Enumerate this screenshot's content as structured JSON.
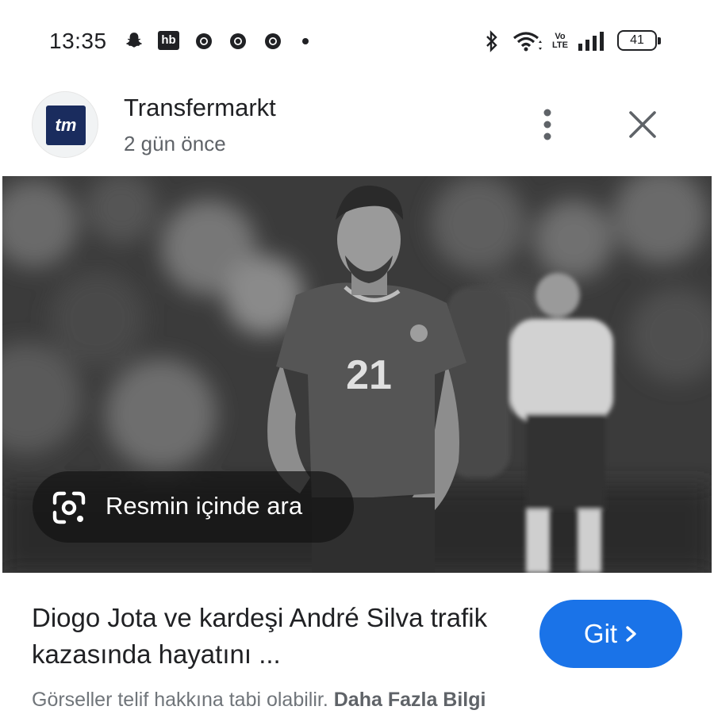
{
  "status_bar": {
    "time": "13:35",
    "left_icons": [
      "snapchat-icon",
      "hb-icon",
      "chrome-icon",
      "chrome-icon",
      "chrome-icon",
      "dot-icon"
    ],
    "hb_label": "hb",
    "right_icons": [
      "bluetooth-icon",
      "wifi-icon",
      "volte-icon",
      "signal-icon",
      "battery-icon"
    ],
    "volte_label": "Vo\nLTE",
    "battery_level": "41"
  },
  "header": {
    "source_name": "Transfermarkt",
    "logo_text": "tm",
    "time_ago": "2 gün önce",
    "more_icon": "more-vert-icon",
    "close_icon": "close-icon"
  },
  "image": {
    "lens_label": "Resmin içinde ara",
    "lens_icon": "google-lens-icon",
    "jersey_number": "21"
  },
  "caption": {
    "headline": "Diogo Jota ve kardeşi André Silva trafik kazasında hayatını ...",
    "go_button": "Git",
    "go_icon": "chevron-right-icon",
    "copyright_text": "Görseller telif hakkına tabi olabilir.",
    "more_info_link": "Daha Fazla Bilgi"
  },
  "colors": {
    "accent": "#1a73e8",
    "logo_bg": "#1a2c5e"
  }
}
